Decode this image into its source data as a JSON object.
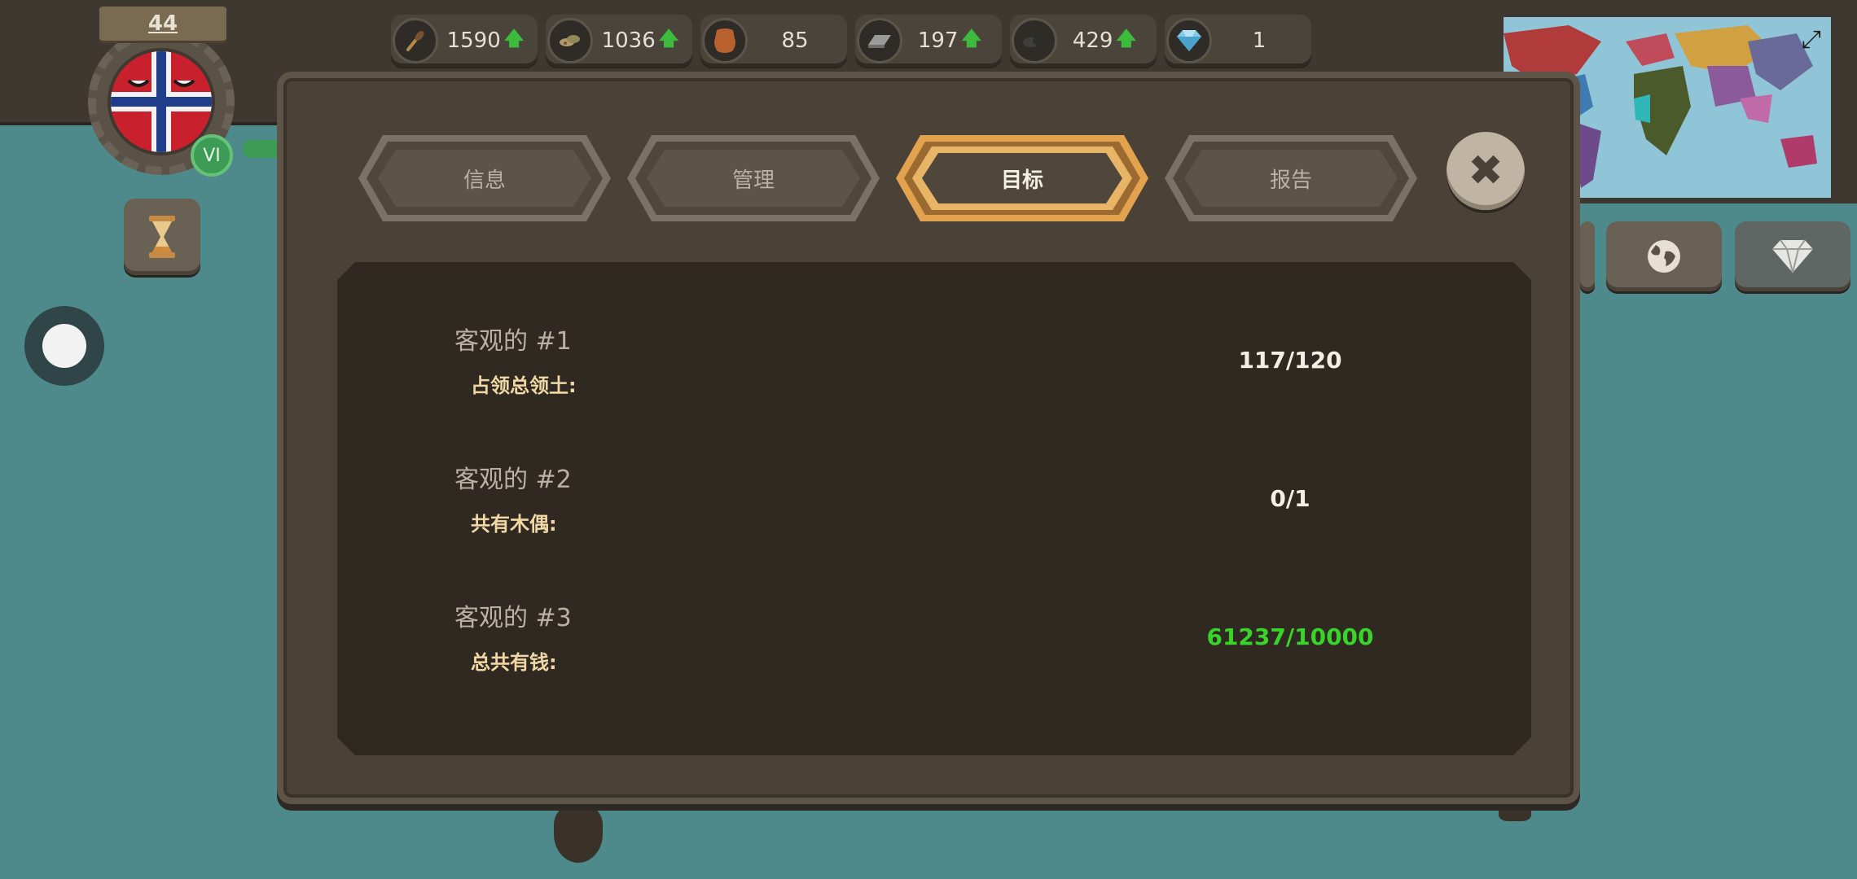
{
  "resources": [
    {
      "icon": "wheat-icon",
      "value": "1590",
      "trend": "up"
    },
    {
      "icon": "lumber-icon",
      "value": "1036",
      "trend": "up"
    },
    {
      "icon": "leather-icon",
      "value": "85",
      "trend": ""
    },
    {
      "icon": "iron-icon",
      "value": "197",
      "trend": "up"
    },
    {
      "icon": "coal-icon",
      "value": "429",
      "trend": "up"
    },
    {
      "icon": "diamond-icon",
      "value": "1",
      "trend": ""
    }
  ],
  "player": {
    "level": "44",
    "rank": "VI",
    "flag": "united-kingdom-flag"
  },
  "tabs": [
    {
      "label": "信息",
      "active": false
    },
    {
      "label": "管理",
      "active": false
    },
    {
      "label": "目标",
      "active": true
    },
    {
      "label": "报告",
      "active": false
    }
  ],
  "objectives": [
    {
      "title": "客观的 #1",
      "description": "占领总领土:",
      "progress": "117/120",
      "complete": false
    },
    {
      "title": "客观的 #2",
      "description": "共有木偶:",
      "progress": "0/1",
      "complete": false
    },
    {
      "title": "客观的 #3",
      "description": "总共有钱:",
      "progress": "61237/10000",
      "complete": true
    }
  ],
  "colors": {
    "accent_active_tab": "#e2a24e",
    "complete_text": "#39d42a",
    "panel_bg": "#4a4236",
    "ocean": "#4e8a8c"
  }
}
